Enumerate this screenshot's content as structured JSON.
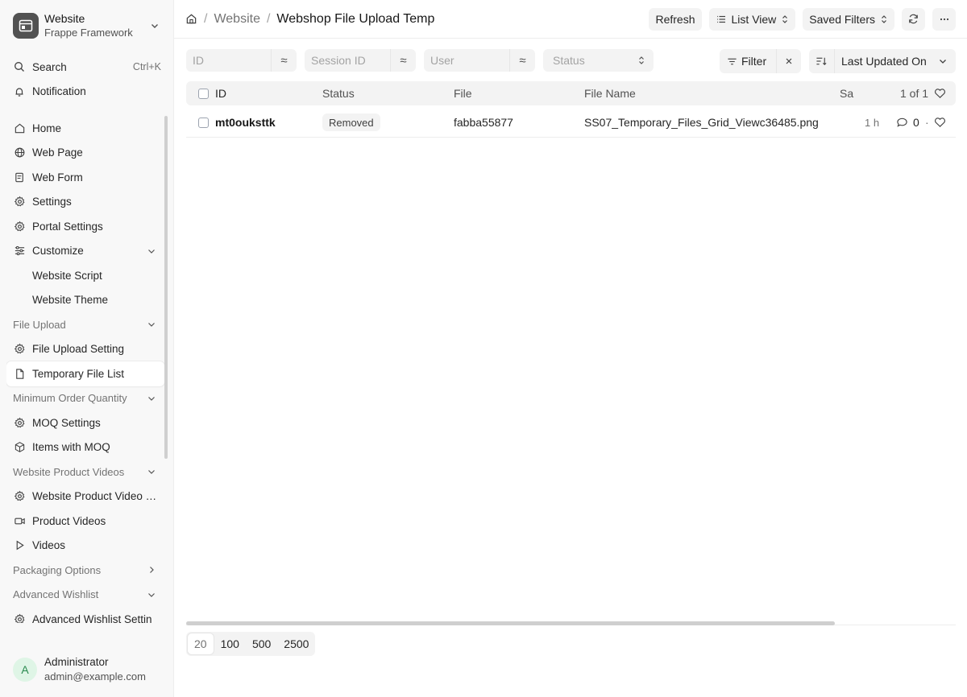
{
  "app": {
    "title": "Website",
    "subtitle": "Frappe Framework"
  },
  "search": {
    "label": "Search",
    "shortcut": "Ctrl+K"
  },
  "notification": {
    "label": "Notification"
  },
  "sidebar": {
    "items": [
      {
        "label": "Home",
        "icon": "home-icon",
        "type": "item"
      },
      {
        "label": "Web Page",
        "icon": "globe-icon",
        "type": "item"
      },
      {
        "label": "Web Form",
        "icon": "form-icon",
        "type": "item"
      },
      {
        "label": "Settings",
        "icon": "gear-icon",
        "type": "item"
      },
      {
        "label": "Portal Settings",
        "icon": "gear-icon",
        "type": "item"
      },
      {
        "label": "Customize",
        "icon": "sliders-icon",
        "type": "item",
        "chevron": "down"
      },
      {
        "label": "Website Script",
        "type": "sub"
      },
      {
        "label": "Website Theme",
        "type": "sub"
      },
      {
        "label": "File Upload",
        "type": "group",
        "chevron": "down"
      },
      {
        "label": "File Upload Setting",
        "icon": "gear-icon",
        "type": "item"
      },
      {
        "label": "Temporary File List",
        "icon": "file-icon",
        "type": "item",
        "active": true
      },
      {
        "label": "Minimum Order Quantity",
        "type": "group",
        "chevron": "down"
      },
      {
        "label": "MOQ Settings",
        "icon": "gear-icon",
        "type": "item"
      },
      {
        "label": "Items with MOQ",
        "icon": "box-icon",
        "type": "item"
      },
      {
        "label": "Website Product Videos",
        "type": "group",
        "chevron": "down"
      },
      {
        "label": "Website Product Video S...",
        "icon": "gear-icon",
        "type": "item"
      },
      {
        "label": "Product Videos",
        "icon": "video-icon",
        "type": "item"
      },
      {
        "label": "Videos",
        "icon": "play-icon",
        "type": "item"
      },
      {
        "label": "Packaging Options",
        "type": "group",
        "chevron": "right"
      },
      {
        "label": "Advanced Wishlist",
        "type": "group",
        "chevron": "down"
      },
      {
        "label": "Advanced Wishlist Settin",
        "icon": "gear-icon",
        "type": "item"
      }
    ]
  },
  "user": {
    "initial": "A",
    "name": "Administrator",
    "email": "admin@example.com"
  },
  "header": {
    "breadcrumb": [
      "Website",
      "Webshop File Upload Temp"
    ],
    "refresh_label": "Refresh",
    "view_label": "List View",
    "saved_filters_label": "Saved Filters"
  },
  "filters": {
    "id_placeholder": "ID",
    "session_placeholder": "Session ID",
    "user_placeholder": "User",
    "status_placeholder": "Status",
    "approx_symbol": "≈",
    "filter_label": "Filter",
    "sort_label": "Last Updated On"
  },
  "table": {
    "headers": {
      "id": "ID",
      "status": "Status",
      "file": "File",
      "file_name": "File Name",
      "sa": "Sa",
      "count": "1 of 1"
    },
    "rows": [
      {
        "id": "mt0ouksttk",
        "status": "Removed",
        "file": "fabba55877",
        "file_name": "SS07_Temporary_Files_Grid_Viewc36485.png",
        "age": "1 h",
        "comments": "0"
      }
    ]
  },
  "paging": {
    "options": [
      "20",
      "100",
      "500",
      "2500"
    ]
  }
}
